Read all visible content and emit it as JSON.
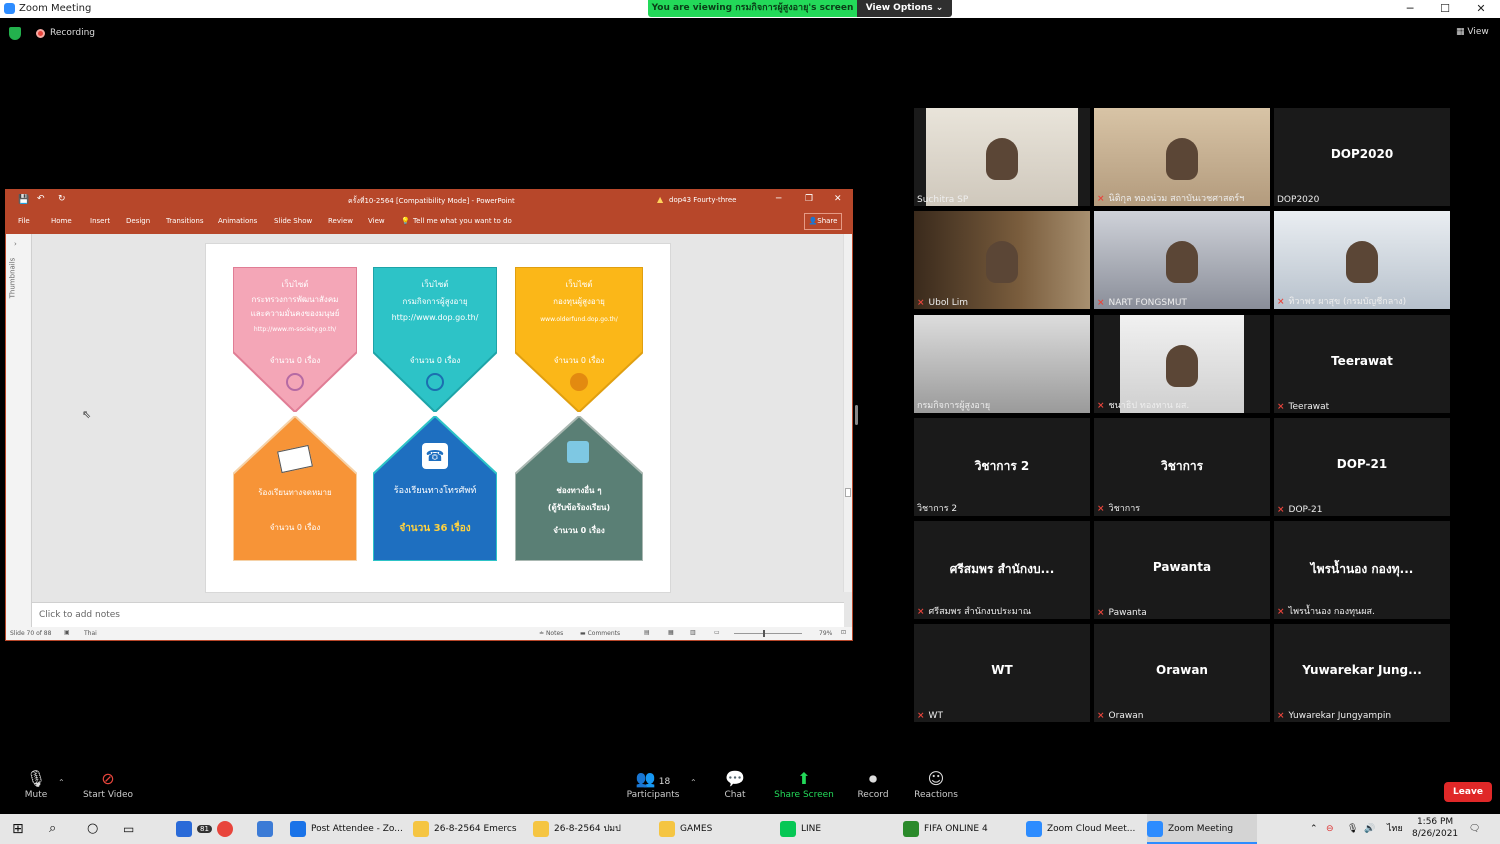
{
  "window": {
    "title": "Zoom Meeting",
    "viewing_banner": "You are viewing กรมกิจการผู้สูงอายุ's screen",
    "view_options": "View Options ⌄",
    "minimize": "─",
    "maximize": "☐",
    "close": "✕"
  },
  "topbar": {
    "recording": "Recording",
    "view": "View"
  },
  "powerpoint": {
    "doc_title": "ครั้งที่10-2564 [Compatibility Mode] - PowerPoint",
    "account": "dop43 Fourty-three",
    "tabs": [
      "File",
      "Home",
      "Insert",
      "Design",
      "Transitions",
      "Animations",
      "Slide Show",
      "Review",
      "View"
    ],
    "tell_me": "Tell me what you want to do",
    "share": "Share",
    "thumbnails": "Thumbnails",
    "notes_placeholder": "Click to add notes",
    "status_slide": "Slide 70 of 88",
    "status_lang": "Thai",
    "status_notes": "Notes",
    "status_comments": "Comments",
    "zoom": "79%",
    "slide": {
      "top_cards": [
        {
          "line1": "เว็บไซต์",
          "line2": "กระทรวงการพัฒนาสังคม",
          "line3": "และความมั่นคงของมนุษย์",
          "url": "http://www.m-society.go.th/",
          "count": "จำนวน 0 เรื่อง",
          "color": "#f4a6b7"
        },
        {
          "line1": "เว็บไซต์",
          "line2": "กรมกิจการผู้สูงอายุ",
          "line3": "",
          "url": "http://www.dop.go.th/",
          "count": "จำนวน 0 เรื่อง",
          "color": "#2dc3c7"
        },
        {
          "line1": "เว็บไซต์",
          "line2": "กองทุนผู้สูงอายุ",
          "line3": "",
          "url": "www.olderfund.dop.go.th/",
          "count": "จำนวน 0 เรื่อง",
          "color": "#fbb718"
        }
      ],
      "bottom_cards": [
        {
          "title": "ร้องเรียนทางจดหมาย",
          "sub": "",
          "count": "จำนวน 0 เรื่อง",
          "color": "#f79437"
        },
        {
          "title": "ร้องเรียนทางโทรศัพท์",
          "sub": "",
          "count": "จำนวน 36 เรื่อง",
          "color": "#1e6fc0"
        },
        {
          "title": "ช่องทางอื่น ๆ",
          "sub": "(ตู้รับข้อร้องเรียน)",
          "count": "จำนวน 0 เรื่อง",
          "color": "#5a7f75"
        }
      ]
    }
  },
  "participants": [
    {
      "name": "Suchitra SP",
      "label": "",
      "muted": false,
      "video": true
    },
    {
      "name": "นิติกุล ทองน่วม สถาบันเวชศาสตร์ฯ",
      "label": "",
      "muted": true,
      "video": true
    },
    {
      "name": "DOP2020",
      "label": "DOP2020",
      "muted": false,
      "video": false
    },
    {
      "name": "Ubol Lim",
      "label": "",
      "muted": true,
      "video": true
    },
    {
      "name": "NART FONGSMUT",
      "label": "",
      "muted": true,
      "video": true
    },
    {
      "name": "ทิวาพร ผาสุข (กรมบัญชีกลาง)",
      "label": "",
      "muted": true,
      "video": true
    },
    {
      "name": "กรมกิจการผู้สูงอายุ",
      "label": "",
      "muted": false,
      "video": true
    },
    {
      "name": "ชนาธิป ทองทาน ผส.",
      "label": "",
      "muted": true,
      "video": true
    },
    {
      "name": "Teerawat",
      "label": "Teerawat",
      "muted": true,
      "video": false
    },
    {
      "name": "วิชาการ 2",
      "label": "วิชาการ 2",
      "muted": false,
      "video": false
    },
    {
      "name": "วิชาการ",
      "label": "วิชาการ",
      "muted": true,
      "video": false
    },
    {
      "name": "DOP-21",
      "label": "DOP-21",
      "muted": true,
      "video": false
    },
    {
      "name": "ศรีสมพร สำนักงบประมาณ",
      "label": "ศรีสมพร สำนักงบ...",
      "muted": true,
      "video": false
    },
    {
      "name": "Pawanta",
      "label": "Pawanta",
      "muted": true,
      "video": false
    },
    {
      "name": "ไพรน้ำนอง กองทุนผส.",
      "label": "ไพรน้ำนอง กองทุ...",
      "muted": true,
      "video": false
    },
    {
      "name": "WT",
      "label": "WT",
      "muted": true,
      "video": false
    },
    {
      "name": "Orawan",
      "label": "Orawan",
      "muted": true,
      "video": false
    },
    {
      "name": "Yuwarekar Jungyampin",
      "label": "Yuwarekar  Jung...",
      "muted": true,
      "video": false
    }
  ],
  "toolbar": {
    "mute": "Mute",
    "start_video": "Start Video",
    "participants": "Participants",
    "participant_count": "18",
    "chat": "Chat",
    "share_screen": "Share Screen",
    "record": "Record",
    "reactions": "Reactions",
    "leave": "Leave"
  },
  "taskbar": {
    "apps": [
      {
        "label": "Post Attendee - Zo...",
        "color": "#1a73e8"
      },
      {
        "label": "26-8-2564 Emercs",
        "color": "#f5c542"
      },
      {
        "label": "26-8-2564 ปมป",
        "color": "#f5c542"
      },
      {
        "label": "GAMES",
        "color": "#f5c542"
      },
      {
        "label": "LINE",
        "color": "#06c755"
      },
      {
        "label": "FIFA ONLINE 4",
        "color": "#2a8a2a"
      },
      {
        "label": "Zoom Cloud Meet...",
        "color": "#2d8cff"
      },
      {
        "label": "Zoom Meeting",
        "color": "#2d8cff"
      }
    ],
    "mail_badge": "81",
    "lang": "ไทย",
    "time": "1:56 PM",
    "date": "8/26/2021"
  },
  "colors": {
    "ppt_red": "#b7472a",
    "zoom_green": "#23d959",
    "leave_red": "#e02828",
    "selected_border": "#f0e24a"
  }
}
